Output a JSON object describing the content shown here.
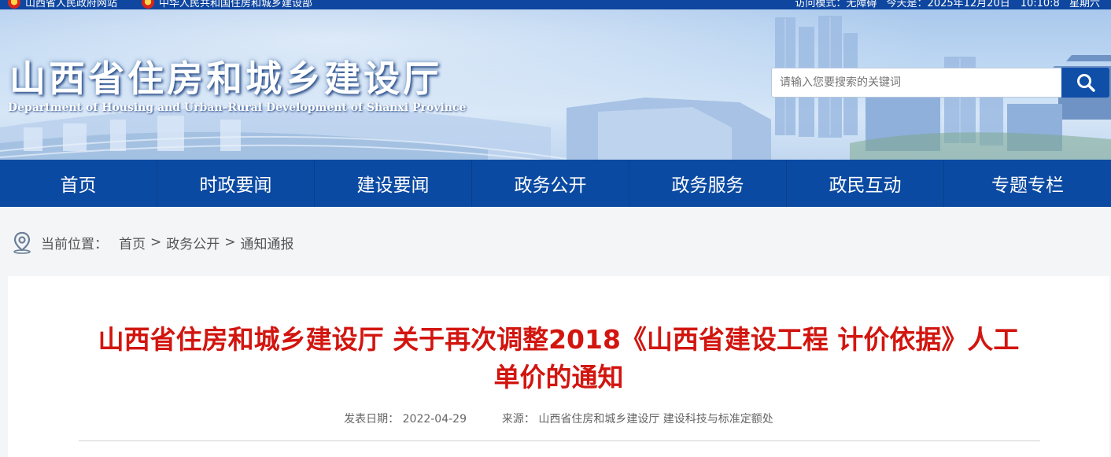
{
  "topbar": {
    "link1": "山西省人民政府网站",
    "link2": "中华人民共和国住房和城乡建设部",
    "welcome": "访问模式：无障碍",
    "date": "今天是：2025年12月20日　10:10:8",
    "week": "星期六"
  },
  "header": {
    "title": "山西省住房和城乡建设厅",
    "subtitle": "Department of Housing and Urban–Rural Development of Shanxi Province",
    "search_placeholder": "请输入您要搜索的关键词"
  },
  "nav": {
    "items": [
      "首页",
      "时政要闻",
      "建设要闻",
      "政务公开",
      "政务服务",
      "政民互动",
      "专题专栏"
    ]
  },
  "breadcrumb": {
    "label": "当前位置：",
    "items": [
      "首页",
      "政务公开",
      "通知通报"
    ],
    "separator": ">"
  },
  "article": {
    "title": "山西省住房和城乡建设厅 关于再次调整2018《山西省建设工程 计价依据》人工单价的通知",
    "date_label": "发表日期：",
    "date": "2022-04-29",
    "source_label": "来源：",
    "source": "山西省住房和城乡建设厅 建设科技与标准定额处"
  },
  "colors": {
    "nav_bg": "#0b4aa2",
    "title_red": "#d2150f",
    "search_btn": "#0f4fa8"
  }
}
